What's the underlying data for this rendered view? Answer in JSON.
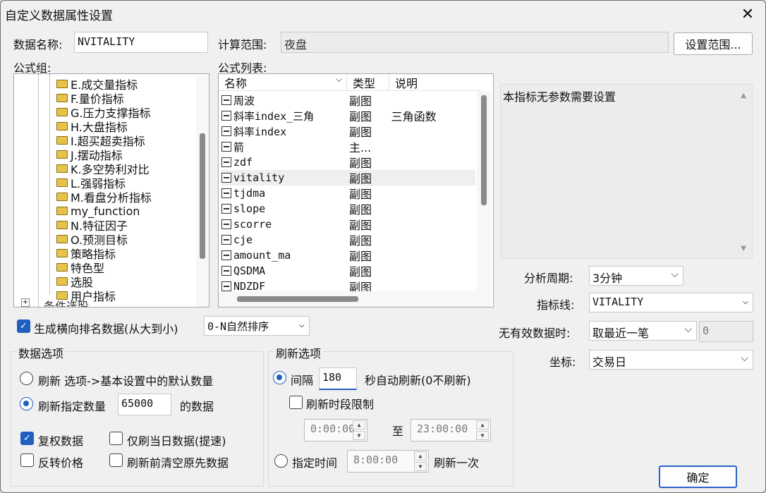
{
  "dialog": {
    "title": "自定义数据属性设置",
    "close": "✕"
  },
  "name": {
    "label": "数据名称:",
    "value": "NVITALITY"
  },
  "calc": {
    "label": "计算范围:",
    "value": "夜盘",
    "button": "设置范围..."
  },
  "groups": {
    "label": "公式组:",
    "items": [
      "E.成交量指标",
      "F.量价指标",
      "G.压力支撑指标",
      "H.大盘指标",
      "I.超买超卖指标",
      "J.摆动指标",
      "K.多空势利对比",
      "L.强弱指标",
      "M.看盘分析指标",
      "my_function",
      "N.特征因子",
      "O.预测目标",
      "策略指标",
      "特色型",
      "选股",
      "用户指标"
    ],
    "cut_item": "条件选股"
  },
  "formulas": {
    "label": "公式列表:",
    "headers": [
      "名称",
      "类型",
      "说明"
    ],
    "rows": [
      {
        "name": "周波",
        "type": "副图",
        "desc": ""
      },
      {
        "name": "斜率index_三角",
        "type": "副图",
        "desc": "三角函数"
      },
      {
        "name": "斜率index",
        "type": "副图",
        "desc": ""
      },
      {
        "name": "箭",
        "type": "主...",
        "desc": ""
      },
      {
        "name": "zdf",
        "type": "副图",
        "desc": ""
      },
      {
        "name": "vitality",
        "type": "副图",
        "desc": ""
      },
      {
        "name": "tjdma",
        "type": "副图",
        "desc": ""
      },
      {
        "name": "slope",
        "type": "副图",
        "desc": ""
      },
      {
        "name": "scorre",
        "type": "副图",
        "desc": ""
      },
      {
        "name": "cje",
        "type": "副图",
        "desc": ""
      },
      {
        "name": "amount_ma",
        "type": "副图",
        "desc": ""
      },
      {
        "name": "QSDMA",
        "type": "副图",
        "desc": ""
      },
      {
        "name": "NDZDF",
        "type": "副图",
        "desc": ""
      }
    ]
  },
  "desc_text": "本指标无参数需要设置",
  "period": {
    "label": "分析周期:",
    "value": "3分钟"
  },
  "indline": {
    "label": "指标线:",
    "value": "VITALITY"
  },
  "invalid": {
    "label": "无有效数据时:",
    "value": "取最近一笔",
    "num": "0"
  },
  "coord": {
    "label": "坐标:",
    "value": "交易日"
  },
  "rank": {
    "label": "生成横向排名数据(从大到小)",
    "value": "0-N自然排序"
  },
  "data_opts": {
    "title": "数据选项",
    "r1": "刷新 选项->基本设置中的默认数量",
    "r2": "刷新指定数量",
    "count": "65000",
    "r2_suffix": "的数据",
    "c1": "复权数据",
    "c2": "仅刷当日数据(提速)",
    "c3": "反转价格",
    "c4": "刷新前清空原先数据"
  },
  "refresh_opts": {
    "title": "刷新选项",
    "r1": "间隔",
    "interval": "180",
    "r1_suffix": "秒自动刷新(0不刷新)",
    "c1": "刷新时段限制",
    "from": "0:00:00",
    "to_label": "至",
    "to": "23:00:00",
    "r2": "指定时间",
    "time": "8:00:00",
    "r2_suffix": "刷新一次"
  },
  "ok": "确定"
}
